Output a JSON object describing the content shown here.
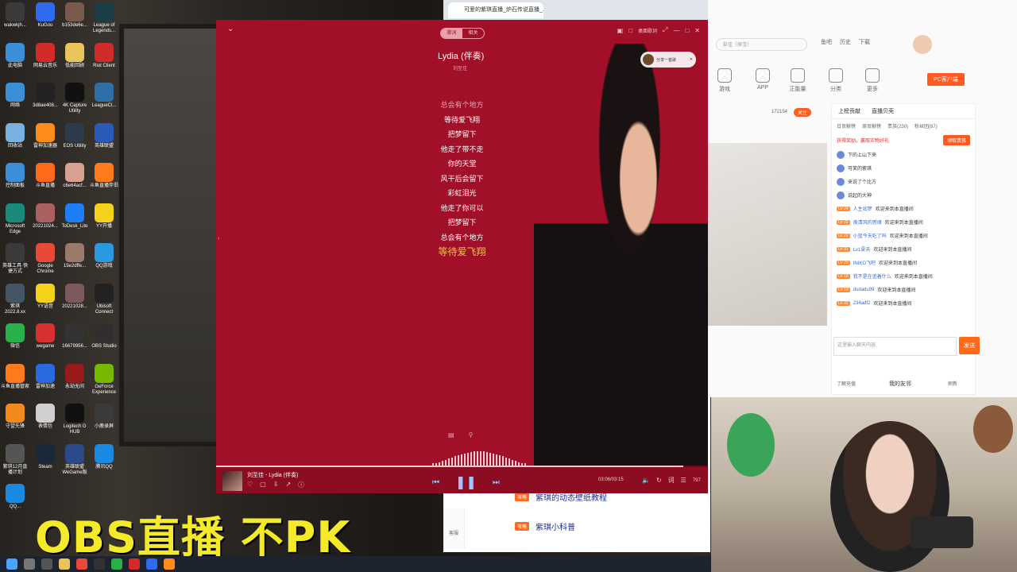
{
  "desktop": {
    "icons": [
      {
        "label": "wakwkjh...",
        "color": "#3a3a3a"
      },
      {
        "label": "KuGou",
        "color": "#2e6bf0"
      },
      {
        "label": "b153de6e...",
        "color": "#7a5a4a"
      },
      {
        "label": "League of Legends...",
        "color": "#1a3d48"
      },
      {
        "label": "此电脑",
        "color": "#3b8fd8"
      },
      {
        "label": "网易云音乐",
        "color": "#d42a2a"
      },
      {
        "label": "低能回顾",
        "color": "#e8c45a"
      },
      {
        "label": "Riot Client",
        "color": "#d02b2b"
      },
      {
        "label": "网络",
        "color": "#3b8fd8"
      },
      {
        "label": "3d8ae408...",
        "color": "#222222"
      },
      {
        "label": "4K Capture Utility",
        "color": "#111111"
      },
      {
        "label": "LeagueCl...",
        "color": "#2f6fa8"
      },
      {
        "label": "回收站",
        "color": "#7ab0e0"
      },
      {
        "label": "雷神加速器",
        "color": "#ff8c1a"
      },
      {
        "label": "EOS Utility",
        "color": "#2d3a4a"
      },
      {
        "label": "英雄联盟",
        "color": "#2a5bb8"
      },
      {
        "label": "控制面板",
        "color": "#3b8fd8"
      },
      {
        "label": "斗鱼直播",
        "color": "#ff6a1a"
      },
      {
        "label": "c6e64acf...",
        "color": "#d8a090"
      },
      {
        "label": "斗鱼直播伴侣",
        "color": "#ff7a1a"
      },
      {
        "label": "Microsoft Edge",
        "color": "#1a8a7a"
      },
      {
        "label": "20221024...",
        "color": "#aa6060"
      },
      {
        "label": "ToDesk_Lite",
        "color": "#1e7ef5"
      },
      {
        "label": "YY开播",
        "color": "#f5d21a"
      },
      {
        "label": "英雄工具·快捷方式",
        "color": "#3a3a3a"
      },
      {
        "label": "Google Chrome",
        "color": "#e84a3a"
      },
      {
        "label": "15e2dffe...",
        "color": "#9a7a6a"
      },
      {
        "label": "QQ游戏",
        "color": "#2a9ae0"
      },
      {
        "label": "紫琪 2022.8.xx",
        "color": "#445566"
      },
      {
        "label": "YY语音",
        "color": "#f5d21a"
      },
      {
        "label": "20221028...",
        "color": "#7a5a5a"
      },
      {
        "label": "Ubisoft Connect",
        "color": "#222222"
      },
      {
        "label": "微信",
        "color": "#2ab04a"
      },
      {
        "label": "wegame",
        "color": "#d63030"
      },
      {
        "label": "16679956...",
        "color": "#333333"
      },
      {
        "label": "OBS Studio",
        "color": "#302e31"
      },
      {
        "label": "斗鱼直播管家",
        "color": "#ff7a1a"
      },
      {
        "label": "雷神加速",
        "color": "#2a6ae0"
      },
      {
        "label": "永劫无间",
        "color": "#9a1a1a"
      },
      {
        "label": "GeForce Experience",
        "color": "#76b900"
      },
      {
        "label": "守望先锋",
        "color": "#f08a1a"
      },
      {
        "label": "表情包",
        "color": "#d0d0d0"
      },
      {
        "label": "Logitech G HUB",
        "color": "#111111"
      },
      {
        "label": "小鹿录屏",
        "color": "#3a3a3a"
      },
      {
        "label": "紫琪12月直播计划",
        "color": "#555555"
      },
      {
        "label": "Steam",
        "color": "#1b2838"
      },
      {
        "label": "英雄联盟WeGame版",
        "color": "#2a4a8a"
      },
      {
        "label": "腾讯QQ",
        "color": "#1a8ae0"
      },
      {
        "label": "QQ...",
        "color": "#1a8ae0"
      }
    ]
  },
  "overlay": {
    "text": "OBS直播 不PK"
  },
  "browser": {
    "tab_title": "可爱的紫琪直播_炉石传说直播_...",
    "bottom_items": [
      {
        "badge": "攻略",
        "label": "紫琪的动态壁纸教程"
      },
      {
        "badge": "攻略",
        "label": "紫琪小科普"
      }
    ],
    "service_label": "客服"
  },
  "stream_panel": {
    "search_placeholder": "彭佳（探宝）",
    "nav": [
      "鱼吧",
      "历史",
      "下载",
      "个人中心"
    ],
    "nav2": [
      "游戏",
      "APP",
      "正能量",
      "分类",
      "更多"
    ],
    "pc_button": "PC客户端",
    "viewers": "172154",
    "follow": "关注",
    "chat_tabs": [
      "上榜贡献",
      "直播贝壳"
    ],
    "rank_tabs": [
      "日贡献榜",
      "周贡献榜",
      "贵族(230)",
      "粉丝团(87)"
    ],
    "sign_tip": "获得奖励，赢取实物好礼",
    "sign_btn": "领取贵族",
    "chat_lines": [
      {
        "lv": "",
        "name": "",
        "text": "下的上山下来"
      },
      {
        "lv": "",
        "name": "",
        "text": "可笑的紫琪"
      },
      {
        "lv": "",
        "name": "",
        "text": "来说了个比方"
      },
      {
        "lv": "",
        "name": "",
        "text": "说起的大神"
      },
      {
        "lv": "LV 24",
        "name": "人生如梦",
        "text": "欢迎来到本直播间"
      },
      {
        "lv": "LV 29",
        "name": "挽清风的思绪",
        "text": "欢迎来到本直播间"
      },
      {
        "lv": "LV 22",
        "name": "小蓝今天吃了吗",
        "text": "欢迎来到本直播间"
      },
      {
        "lv": "LV 31",
        "name": "Lx1夏天",
        "text": "欢迎来到本直播间"
      },
      {
        "lv": "LV 20",
        "name": "INIKO飞吧",
        "text": "欢迎来到本直播间"
      },
      {
        "lv": "LV 18",
        "name": "我不是在追着什么",
        "text": "欢迎来到本直播间"
      },
      {
        "lv": "LV 19",
        "name": "dudadu99",
        "text": "欢迎来到本直播间"
      },
      {
        "lv": "LV 22",
        "name": "234adf2",
        "text": "欢迎来到本直播间"
      }
    ],
    "input_placeholder": "这里输入聊天内容",
    "send": "发送",
    "footer_left": "了解充值",
    "footer_mid": "我的友邻",
    "footer_right": "刷新"
  },
  "player": {
    "tabs": [
      "歌词",
      "相关"
    ],
    "desk_lyric": "桌面歌词",
    "title": "Lydia (伴奏)",
    "artist": "刘至佳",
    "notify": "分享一首歌",
    "lyrics": [
      {
        "text": "总会有个地方",
        "state": "dim"
      },
      {
        "text": "等待爱飞翔",
        "state": "normal"
      },
      {
        "text": "把梦留下",
        "state": "normal"
      },
      {
        "text": "他走了带不走",
        "state": "normal"
      },
      {
        "text": "你的天堂",
        "state": "normal"
      },
      {
        "text": "风干后会留下",
        "state": "normal"
      },
      {
        "text": "彩虹泪光",
        "state": "normal"
      },
      {
        "text": "他走了你可以",
        "state": "normal"
      },
      {
        "text": "把梦留下",
        "state": "normal"
      },
      {
        "text": "总会有个地方",
        "state": "normal"
      },
      {
        "text": "等待爱飞翔",
        "state": "current"
      }
    ],
    "now_playing": "刘至佳 - Lydia (伴奏)",
    "time": "03:06/03:15",
    "progress": 0.95,
    "playlist_count": "797",
    "accent": "#a10f29"
  }
}
